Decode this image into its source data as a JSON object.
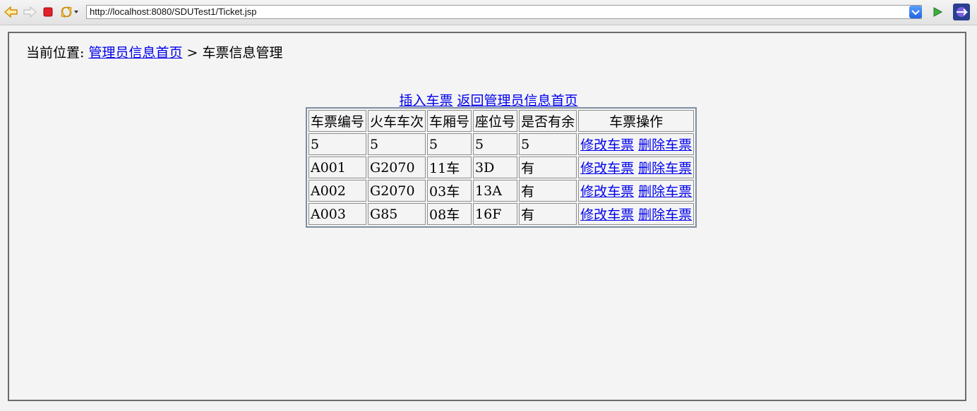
{
  "browser": {
    "url": "http://localhost:8080/SDUTest1/Ticket.jsp",
    "icons": [
      "back-icon",
      "forward-icon",
      "stop-icon",
      "refresh-icon",
      "go-icon",
      "eclipse-icon"
    ]
  },
  "breadcrumb": {
    "prefix": "当前位置: ",
    "home_link": "管理员信息首页",
    "separator": " > ",
    "current": "车票信息管理"
  },
  "actions": {
    "insert": "插入车票",
    "back": "返回管理员信息首页"
  },
  "table": {
    "headers": [
      "车票编号",
      "火车车次",
      "车厢号",
      "座位号",
      "是否有余",
      "车票操作"
    ],
    "edit_label": "修改车票",
    "delete_label": "删除车票",
    "rows": [
      [
        "5",
        "5",
        "5",
        "5",
        "5"
      ],
      [
        "A001",
        "G2070",
        "11车",
        "3D",
        "有"
      ],
      [
        "A002",
        "G2070",
        "03车",
        "13A",
        "有"
      ],
      [
        "A003",
        "G85",
        "08车",
        "16F",
        "有"
      ]
    ]
  }
}
